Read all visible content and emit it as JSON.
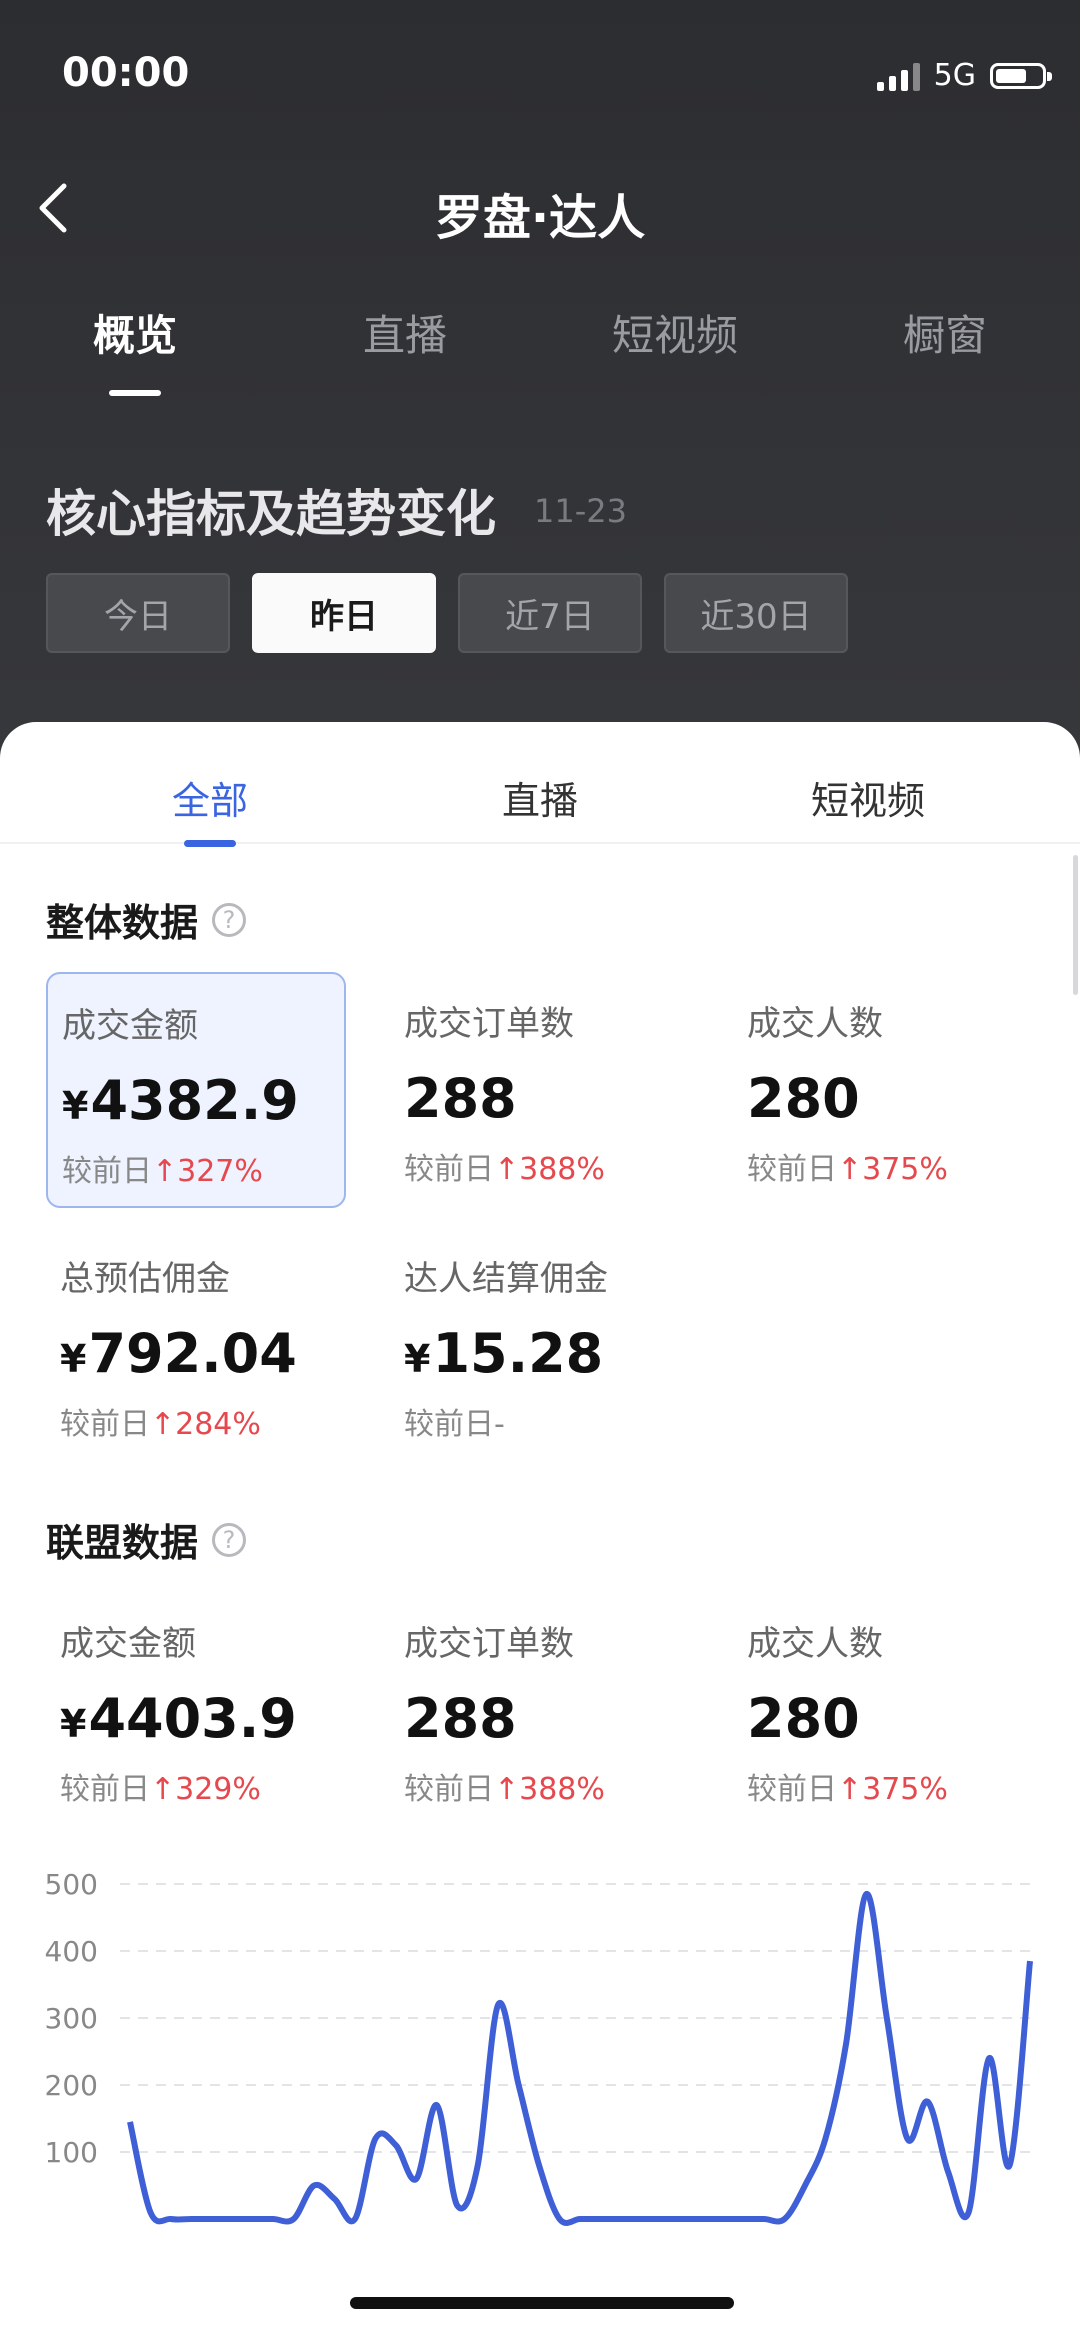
{
  "status_bar": {
    "time": "00:00",
    "network": "5G"
  },
  "nav": {
    "title": "罗盘·达人"
  },
  "main_tabs": [
    {
      "label": "概览",
      "active": true
    },
    {
      "label": "直播",
      "active": false
    },
    {
      "label": "短视频",
      "active": false
    },
    {
      "label": "橱窗",
      "active": false
    }
  ],
  "core": {
    "title": "核心指标及趋势变化",
    "date": "11-23"
  },
  "date_buttons": [
    {
      "label": "今日",
      "active": false
    },
    {
      "label": "昨日",
      "active": true
    },
    {
      "label": "近7日",
      "active": false
    },
    {
      "label": "近30日",
      "active": false
    }
  ],
  "sub_tabs": [
    {
      "label": "全部",
      "active": true
    },
    {
      "label": "直播",
      "active": false
    },
    {
      "label": "短视频",
      "active": false
    }
  ],
  "overall": {
    "title": "整体数据",
    "metrics": [
      {
        "label": "成交金额",
        "currency": "¥",
        "value": "4382.9",
        "cmp_label": "较前日",
        "cmp_value": "↑327%"
      },
      {
        "label": "成交订单数",
        "currency": "",
        "value": "288",
        "cmp_label": "较前日",
        "cmp_value": "↑388%"
      },
      {
        "label": "成交人数",
        "currency": "",
        "value": "280",
        "cmp_label": "较前日",
        "cmp_value": "↑375%"
      },
      {
        "label": "总预估佣金",
        "currency": "¥",
        "value": "792.04",
        "cmp_label": "较前日",
        "cmp_value": "↑284%"
      },
      {
        "label": "达人结算佣金",
        "currency": "¥",
        "value": "15.28",
        "cmp_label": "较前日",
        "cmp_value": "-"
      }
    ]
  },
  "alliance": {
    "title": "联盟数据",
    "metrics": [
      {
        "label": "成交金额",
        "currency": "¥",
        "value": "4403.9",
        "cmp_label": "较前日",
        "cmp_value": "↑329%"
      },
      {
        "label": "成交订单数",
        "currency": "",
        "value": "288",
        "cmp_label": "较前日",
        "cmp_value": "↑388%"
      },
      {
        "label": "成交人数",
        "currency": "",
        "value": "280",
        "cmp_label": "较前日",
        "cmp_value": "↑375%"
      }
    ]
  },
  "chart_data": {
    "type": "line",
    "yticks": [
      100,
      200,
      300,
      400,
      500
    ],
    "ylim": [
      0,
      500
    ],
    "color": "#3f5fd6",
    "series": [
      {
        "values": [
          145,
          10,
          0,
          0,
          0,
          0,
          0,
          0,
          0,
          50,
          30,
          0,
          120,
          110,
          60,
          170,
          20,
          80,
          320,
          200,
          80,
          0,
          0,
          0,
          0,
          0,
          0,
          0,
          0,
          0,
          0,
          0,
          0,
          50,
          120,
          260,
          485,
          300,
          120,
          175,
          70,
          10,
          240,
          80,
          385
        ]
      }
    ]
  }
}
